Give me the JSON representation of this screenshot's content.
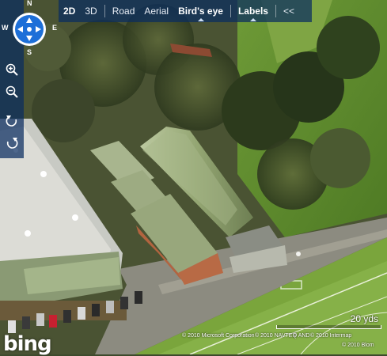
{
  "toolbar": {
    "mode_2d": "2D",
    "mode_3d": "3D",
    "road": "Road",
    "aerial": "Aerial",
    "birds_eye": "Bird's eye",
    "labels": "Labels",
    "collapse": "<<"
  },
  "compass": {
    "n": "N",
    "s": "S",
    "e": "E",
    "w": "W"
  },
  "scale": {
    "label": "20 yds"
  },
  "attribution": {
    "logo": "bing",
    "c1": "© 2010 Microsoft Corporation",
    "c2": "© 2010 NAVTEQ",
    "c3": "© AND",
    "c4": "© 2010 Intermap",
    "c5": "© 2010 Blom"
  },
  "colors": {
    "toolbar_bg": "#0a2d5f",
    "compass_blue": "#1d6fd8"
  },
  "icons": [
    "compass-icon",
    "zoom-in-icon",
    "zoom-out-icon",
    "rotate-left-icon",
    "rotate-right-icon"
  ]
}
